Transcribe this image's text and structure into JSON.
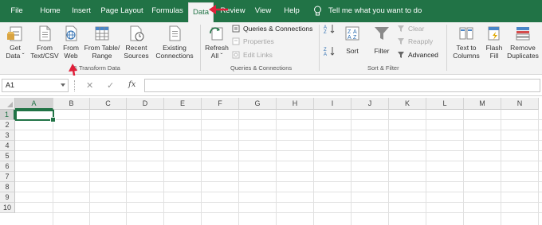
{
  "tabs": [
    {
      "label": "File",
      "active": false
    },
    {
      "label": "Home",
      "active": false
    },
    {
      "label": "Insert",
      "active": false
    },
    {
      "label": "Page Layout",
      "active": false
    },
    {
      "label": "Formulas",
      "active": false
    },
    {
      "label": "Data",
      "active": true
    },
    {
      "label": "Review",
      "active": false
    },
    {
      "label": "View",
      "active": false
    },
    {
      "label": "Help",
      "active": false
    }
  ],
  "tell_me": "Tell me what you want to do",
  "ribbon": {
    "get_data": {
      "line1": "Get",
      "line2": "Data ˇ"
    },
    "from_text_csv": {
      "line1": "From",
      "line2": "Text/CSV"
    },
    "from_web": {
      "line1": "From",
      "line2": "Web"
    },
    "from_table_range": {
      "line1": "From Table/",
      "line2": "Range"
    },
    "recent_sources": {
      "line1": "Recent",
      "line2": "Sources"
    },
    "existing_connections": {
      "line1": "Existing",
      "line2": "Connections"
    },
    "refresh_all": {
      "line1": "Refresh",
      "line2": "All ˇ"
    },
    "queries_connections": "Queries & Connections",
    "properties": "Properties",
    "edit_links": "Edit Links",
    "sort": "Sort",
    "filter": "Filter",
    "clear": "Clear",
    "reapply": "Reapply",
    "advanced": "Advanced",
    "text_to_columns": {
      "line1": "Text to",
      "line2": "Columns"
    },
    "flash_fill": {
      "line1": "Flash",
      "line2": "Fill"
    },
    "remove_duplicates": {
      "line1": "Remove",
      "line2": "Duplicates"
    },
    "groups": {
      "get_transform": "& Transform Data",
      "queries": "Queries & Connections",
      "sort_filter": "Sort & Filter"
    }
  },
  "formula_bar": {
    "name_box": "A1",
    "cancel": "✕",
    "enter": "✓",
    "fx": "fx",
    "formula": ""
  },
  "columns": [
    "A",
    "B",
    "C",
    "D",
    "E",
    "F",
    "G",
    "H",
    "I",
    "J",
    "K",
    "L",
    "M",
    "N"
  ],
  "rows": [
    "1",
    "2",
    "3",
    "4",
    "5",
    "6",
    "7",
    "8",
    "9",
    "10"
  ],
  "colors": {
    "accent": "#217346",
    "annotation_arrow": "#e0203a"
  },
  "icons": [
    "get-data-icon",
    "text-csv-icon",
    "web-icon",
    "table-icon",
    "recent-sources-icon",
    "connections-icon",
    "refresh-icon",
    "sort-icon",
    "filter-icon",
    "text-to-columns-icon",
    "flash-fill-icon",
    "remove-duplicates-icon",
    "lightbulb-icon"
  ]
}
